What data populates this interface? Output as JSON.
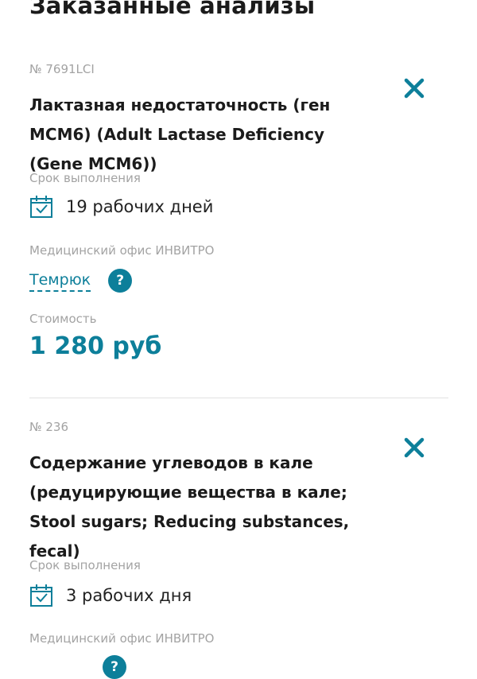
{
  "page": {
    "title": "Заказанные анализы"
  },
  "labels": {
    "duration": "Срок выполнения",
    "office": "Медицинский офис ИНВИТРО",
    "price": "Стоимость"
  },
  "orders": [
    {
      "number": "№ 7691LCI",
      "name": "Лактазная недостаточность (ген MCM6) (Adult Lactase Deficiency (Gene MCM6))",
      "duration": "19 рабочих дней",
      "office": "Темрюк",
      "price": "1 280 руб"
    },
    {
      "number": "№ 236",
      "name": "Содержание углеводов в кале (редуцирующие вещества в кале; Stool sugars; Reducing substances, fecal)",
      "duration": "3 рабочих дня"
    }
  ],
  "icons": {
    "remove": "close-icon",
    "duration": "calendar-check-icon",
    "help": "help-icon"
  },
  "colors": {
    "accent": "#0d7f9a",
    "muted": "#a3a3a3",
    "text": "#1b1b1b"
  }
}
